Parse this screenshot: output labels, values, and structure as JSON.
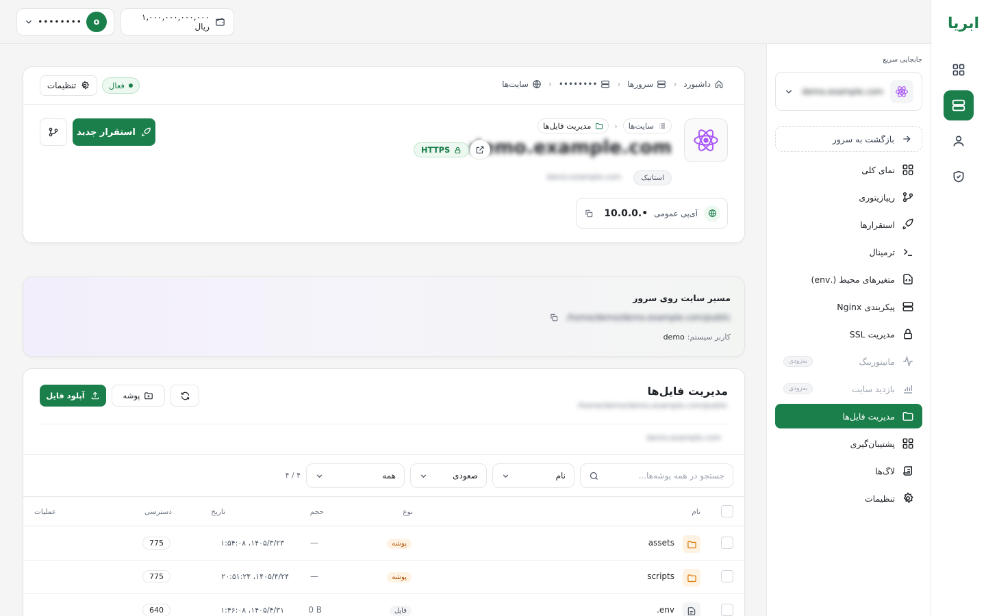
{
  "brand": {
    "logo_text": "ابریا",
    "accent": "#1a7f4b"
  },
  "topbar": {
    "username": "••••••••",
    "avatar_letter": "o",
    "wallet": "۱,۰۰۰,۰۰۰,۰۰۰,۰۰۰ ریال"
  },
  "sidebar": {
    "quick_title": "جابجایی سریع",
    "quick_selected": "demo.example.com",
    "back_label": "بازگشت به سرور",
    "soon_badge": "به‌زودی",
    "items": [
      {
        "label": "نمای کلی",
        "icon": "grid-icon"
      },
      {
        "label": "ریپازیتوری",
        "icon": "git-branch-icon"
      },
      {
        "label": "استقرارها",
        "icon": "rocket-icon"
      },
      {
        "label": "ترمینال",
        "icon": "terminal-icon"
      },
      {
        "label": "متغیرهای محیط (.env)",
        "icon": "file-code-icon"
      },
      {
        "label": "پیکربندی Nginx",
        "icon": "server-icon"
      },
      {
        "label": "مدیریت SSL",
        "icon": "lock-icon"
      },
      {
        "label": "مانیتورینگ",
        "icon": "activity-icon"
      },
      {
        "label": "بازدید سایت",
        "icon": "bar-chart-icon"
      },
      {
        "label": "مدیریت فایل‌ها",
        "icon": "folder-icon"
      },
      {
        "label": "پشتیبان‌گیری",
        "icon": "grid-icon"
      },
      {
        "label": "لاگ‌ها",
        "icon": "scroll-icon"
      },
      {
        "label": "تنظیمات",
        "icon": "gear-icon"
      }
    ]
  },
  "header": {
    "breadcrumb": [
      "داشبورد",
      "سرورها",
      "••••••••",
      "سایت‌ها"
    ],
    "status": "فعال",
    "settings_label": "تنظیمات",
    "sub_crumb": [
      "سایت‌ها",
      "مدیریت فایل‌ها"
    ],
    "domain": "demo.example.com",
    "https_label": "HTTPS",
    "type_label": "استاتیک",
    "subdomain": "demo.example.com",
    "ip_label": "آی‌پی عمومی",
    "ip_value": "10.0.0.•",
    "deploy_label": "استقرار جدید"
  },
  "path_card": {
    "title": "مسیر سایت روی سرور",
    "path": "/home/demo/demo.example.com/public",
    "user_label": "کاربر سیستم:",
    "user_value": "demo"
  },
  "files": {
    "title": "مدیریت فایل‌ها",
    "subtitle": "/home/demo/demo.example.com/public",
    "location": "demo.example.com",
    "upload_label": "آپلود فایل",
    "folder_label": "پوشه",
    "search_placeholder": "جستجو در همه پوشه‌ها...",
    "sort_field": "نام",
    "sort_order": "صعودی",
    "filter": "همه",
    "count": "۴ / ۴",
    "columns": {
      "name": "نام",
      "type": "نوع",
      "size": "حجم",
      "date": "تاریخ",
      "perm": "دسترسی",
      "actions": "عملیات"
    },
    "rows": [
      {
        "name": "assets",
        "type": "پوشه",
        "size": "—",
        "date": "۱۴۰۵/۳/۲۳، ۱:۵۴:۰۸",
        "perm": "775"
      },
      {
        "name": "scripts",
        "type": "پوشه",
        "size": "—",
        "date": "۱۴۰۵/۴/۲۴، ۲۰:۵۱:۲۴",
        "perm": "775"
      },
      {
        "name": ".env",
        "type": "فایل",
        "size": "0 B",
        "date": "۱۴۰۵/۴/۳۱، ۱:۴۶:۰۸",
        "perm": "640"
      }
    ]
  }
}
